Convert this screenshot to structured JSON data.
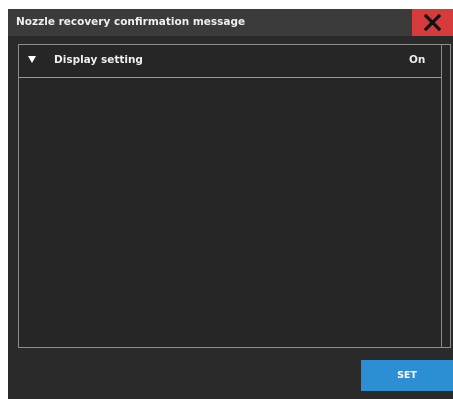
{
  "dialog": {
    "title": "Nozzle recovery confirmation message",
    "close_icon": "close-icon"
  },
  "settings": {
    "rows": [
      {
        "label": "Display setting",
        "value": "On",
        "expand_icon": "triangle-down-icon"
      }
    ]
  },
  "actions": {
    "set_label": "SET"
  },
  "colors": {
    "dialog_background": "#2a2a2a",
    "titlebar_background": "#3b3b3b",
    "close_button": "#d63a3a",
    "set_button": "#2c8fd3",
    "text": "#f0f0f0"
  }
}
